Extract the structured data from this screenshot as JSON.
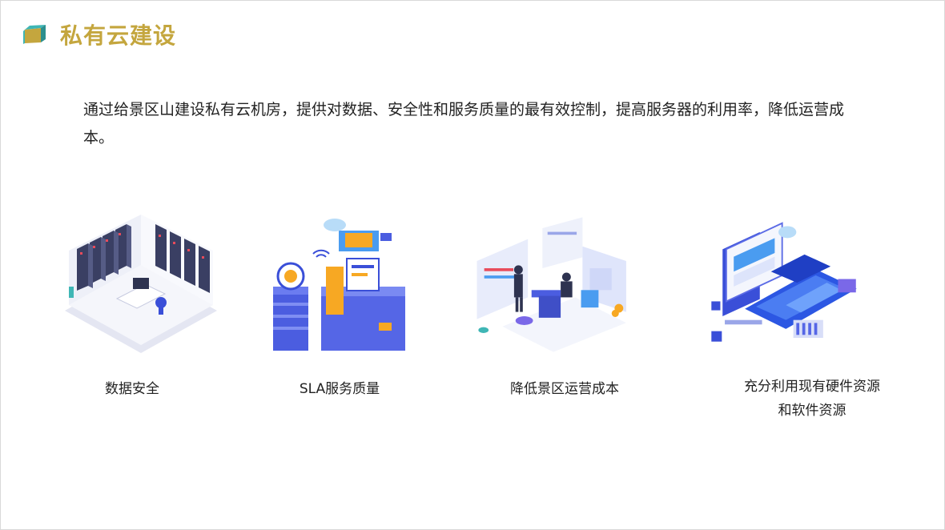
{
  "title": "私有云建设",
  "intro": "通过给景区山建设私有云机房，提供对数据、安全性和服务质量的最有效控制，提高服务器的利用率，降低运营成本。",
  "features": [
    {
      "label": "数据安全",
      "icon": "server-room-illustration"
    },
    {
      "label": "SLA服务质量",
      "icon": "service-quality-illustration"
    },
    {
      "label": "降低景区运营成本",
      "icon": "cost-reduction-illustration"
    },
    {
      "label": "充分利用现有硬件资源和软件资源",
      "icon": "resource-utilization-illustration"
    }
  ],
  "colors": {
    "title": "#c4a63e",
    "text": "#222222",
    "accent_blue": "#3a4fd8",
    "accent_orange": "#f7a823"
  }
}
